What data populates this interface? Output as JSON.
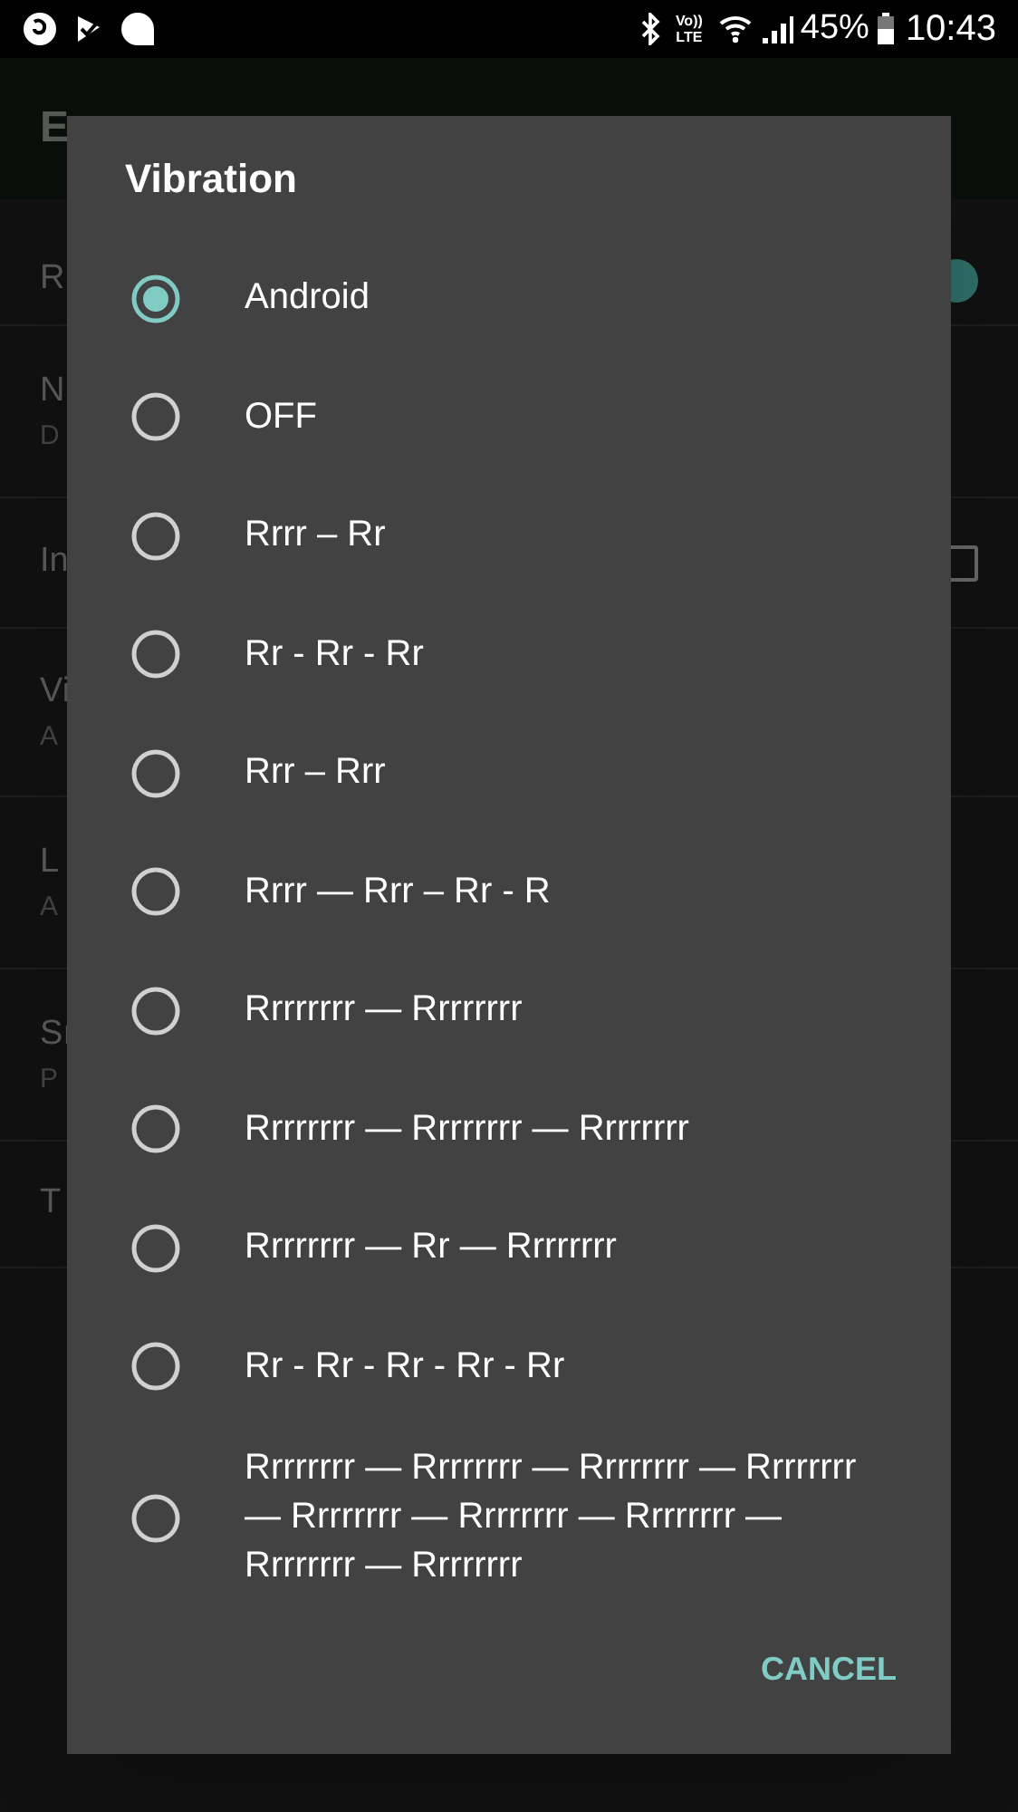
{
  "status_bar": {
    "volte": [
      "Vo))",
      "LTE"
    ],
    "battery_text": "45%",
    "time": "10:43"
  },
  "app_bar": {
    "title": "E"
  },
  "settings": [
    {
      "title": "R",
      "kind": "switch",
      "on": true
    },
    {
      "title": "N",
      "subtitle": "D",
      "kind": "plain"
    },
    {
      "title": "In",
      "kind": "checkbox",
      "checked": false
    },
    {
      "title": "Vi",
      "subtitle": "A",
      "kind": "plain"
    },
    {
      "title": "L",
      "subtitle": "A",
      "kind": "plain"
    },
    {
      "title": "Sı",
      "subtitle": "P",
      "kind": "plain"
    },
    {
      "title": "T",
      "kind": "plain"
    }
  ],
  "dialog": {
    "title": "Vibration",
    "options": [
      {
        "label": "Android",
        "selected": true
      },
      {
        "label": "OFF",
        "selected": false
      },
      {
        "label": "Rrrr – Rr",
        "selected": false
      },
      {
        "label": "Rr - Rr - Rr",
        "selected": false
      },
      {
        "label": "Rrr – Rrr",
        "selected": false
      },
      {
        "label": "Rrrr — Rrr – Rr - R",
        "selected": false
      },
      {
        "label": "Rrrrrrrr — Rrrrrrrr",
        "selected": false
      },
      {
        "label": "Rrrrrrrr — Rrrrrrrr — Rrrrrrrr",
        "selected": false
      },
      {
        "label": "Rrrrrrrr — Rr — Rrrrrrrr",
        "selected": false
      },
      {
        "label": "Rr - Rr - Rr - Rr - Rr",
        "selected": false
      },
      {
        "label": "Rrrrrrrr — Rrrrrrrr — Rrrrrrrr — Rrrrrrrr — Rrrrrrrr — Rrrrrrrr — Rrrrrrrr — Rrrrrrrr — Rrrrrrrr",
        "selected": false
      }
    ],
    "button": "CANCEL"
  }
}
